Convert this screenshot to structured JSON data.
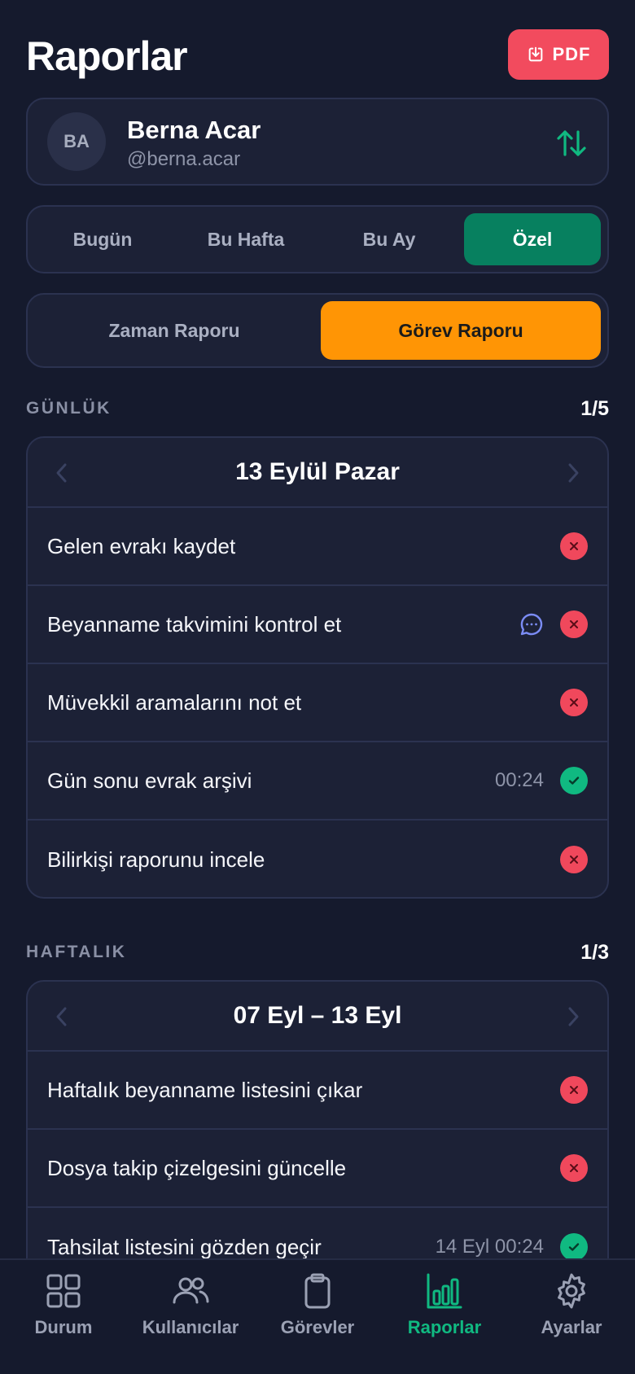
{
  "header": {
    "title": "Raporlar",
    "pdf_label": "PDF"
  },
  "user": {
    "initials": "BA",
    "name": "Berna Acar",
    "handle": "@berna.acar"
  },
  "period_tabs": [
    {
      "label": "Bugün",
      "active": false
    },
    {
      "label": "Bu Hafta",
      "active": false
    },
    {
      "label": "Bu Ay",
      "active": false
    },
    {
      "label": "Özel",
      "active": true
    }
  ],
  "report_tabs": [
    {
      "label": "Zaman Raporu",
      "active": false
    },
    {
      "label": "Görev Raporu",
      "active": true
    }
  ],
  "daily": {
    "label": "GÜNLÜK",
    "count": "1/5",
    "date": "13 Eylül Pazar",
    "tasks": [
      {
        "label": "Gelen evrakı kaydet",
        "time": "",
        "status": "x",
        "comment": false
      },
      {
        "label": "Beyanname takvimini kontrol et",
        "time": "",
        "status": "x",
        "comment": true
      },
      {
        "label": "Müvekkil aramalarını not et",
        "time": "",
        "status": "x",
        "comment": false
      },
      {
        "label": "Gün sonu evrak arşivi",
        "time": "00:24",
        "status": "ok",
        "comment": false
      },
      {
        "label": "Bilirkişi raporunu incele",
        "time": "",
        "status": "x",
        "comment": false
      }
    ]
  },
  "weekly": {
    "label": "HAFTALIK",
    "count": "1/3",
    "date": "07 Eyl – 13 Eyl",
    "tasks": [
      {
        "label": "Haftalık beyanname listesini çıkar",
        "time": "",
        "status": "x",
        "comment": false
      },
      {
        "label": "Dosya takip çizelgesini güncelle",
        "time": "",
        "status": "x",
        "comment": false
      },
      {
        "label": "Tahsilat listesini gözden geçir",
        "time": "14 Eyl 00:24",
        "status": "ok",
        "comment": false
      }
    ]
  },
  "bottom_nav": [
    {
      "label": "Durum",
      "icon": "grid-icon",
      "active": false
    },
    {
      "label": "Kullanıcılar",
      "icon": "users-icon",
      "active": false
    },
    {
      "label": "Görevler",
      "icon": "clipboard-icon",
      "active": false
    },
    {
      "label": "Raporlar",
      "icon": "bar-chart-icon",
      "active": true
    },
    {
      "label": "Ayarlar",
      "icon": "gear-icon",
      "active": false
    }
  ],
  "colors": {
    "accent_green": "#10b981",
    "danger": "#f0485c",
    "orange": "#ff9505",
    "background": "#151a2d"
  }
}
